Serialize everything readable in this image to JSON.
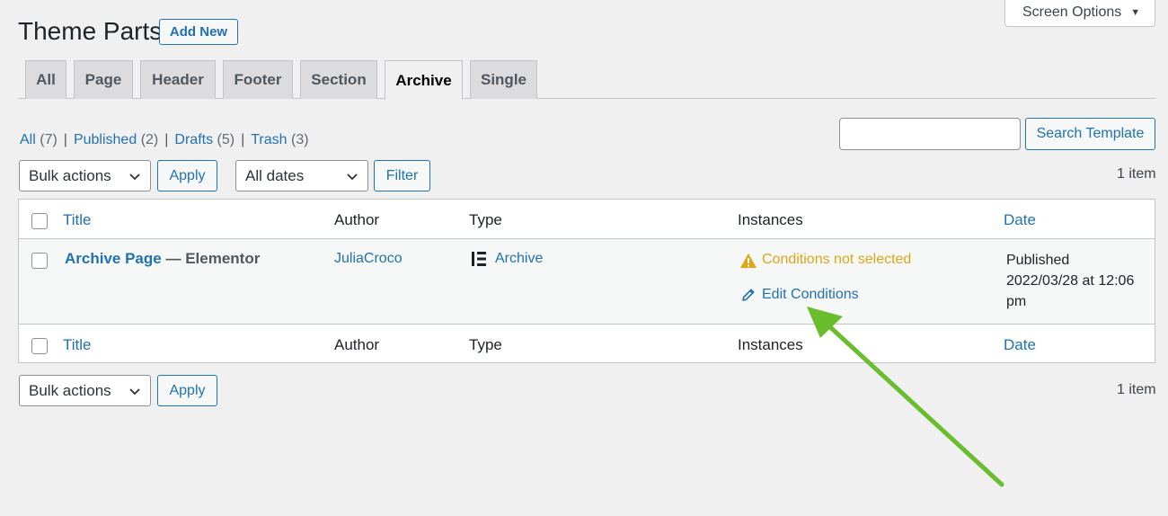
{
  "screen_options": {
    "label": "Screen Options",
    "caret": "▼"
  },
  "header": {
    "title": "Theme Parts",
    "add_new": "Add New"
  },
  "tabs": [
    {
      "label": "All",
      "active": false
    },
    {
      "label": "Page",
      "active": false
    },
    {
      "label": "Header",
      "active": false
    },
    {
      "label": "Footer",
      "active": false
    },
    {
      "label": "Section",
      "active": false
    },
    {
      "label": "Archive",
      "active": true
    },
    {
      "label": "Single",
      "active": false
    }
  ],
  "views": {
    "all": {
      "label": "All",
      "count": "(7)"
    },
    "published": {
      "label": "Published",
      "count": "(2)"
    },
    "drafts": {
      "label": "Drafts",
      "count": "(5)"
    },
    "trash": {
      "label": "Trash",
      "count": "(3)"
    },
    "separator": "|"
  },
  "search": {
    "button": "Search Template",
    "value": ""
  },
  "tablenav_top": {
    "bulk_actions": "Bulk actions",
    "apply": "Apply",
    "dates": "All dates",
    "filter": "Filter",
    "count": "1 item"
  },
  "tablenav_bottom": {
    "bulk_actions": "Bulk actions",
    "apply": "Apply",
    "count": "1 item"
  },
  "columns": {
    "title": "Title",
    "author": "Author",
    "type": "Type",
    "instances": "Instances",
    "date": "Date"
  },
  "row": {
    "title": "Archive Page",
    "title_suffix": "— Elementor",
    "author": "JuliaCroco",
    "type": "Archive",
    "type_icon": "elementor-icon",
    "conditions_warning": "Conditions not selected",
    "edit_conditions": "Edit Conditions",
    "date_status": "Published",
    "date_line1": "2022/03/28 at 12:06",
    "date_line2": "pm"
  },
  "colors": {
    "link": "#2271b1",
    "warning": "#dba617",
    "arrow": "#6abd2d"
  }
}
